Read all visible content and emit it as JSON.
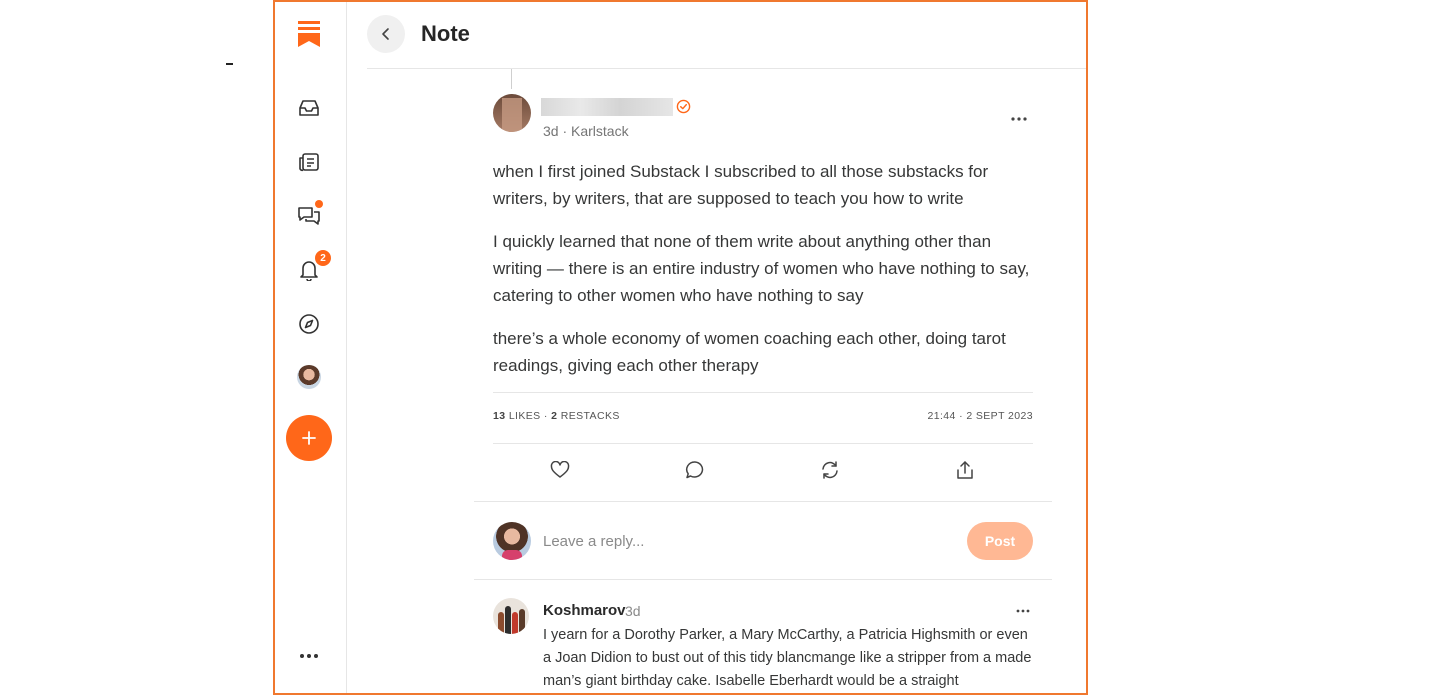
{
  "header": {
    "title": "Note"
  },
  "sidebar": {
    "notifications_badge": "2"
  },
  "post": {
    "meta": "3d · Karlstack",
    "paragraphs": [
      "when I first joined Substack I subscribed to all those substacks for writers, by writers, that are supposed to teach you how to write",
      "I quickly learned that none of them write about anything other than writing — there is an entire industry of women who have nothing to say, catering to other women who have nothing to say",
      "there’s a whole economy of women coaching each other, doing tarot readings, giving each other therapy"
    ],
    "likes_count": "13",
    "likes_label": "LIKES",
    "separator": "·",
    "restacks_count": "2",
    "restacks_label": "RESTACKS",
    "timestamp": "21:44 · 2 SEPT 2023"
  },
  "reply": {
    "placeholder": "Leave a reply...",
    "post_label": "Post"
  },
  "comment": {
    "author": "Koshmarov",
    "time": "3d",
    "body": "I yearn for a Dorothy Parker, a Mary McCarthy, a Patricia Highsmith or even a Joan Didion to bust out of this tidy blancmange like a stripper from a made man’s giant birthday cake. Isabelle Eberhardt would be a straight"
  },
  "colors": {
    "accent": "#ff6719",
    "frame_border": "#f0782f",
    "post_button_disabled": "#ffb894"
  },
  "icons": [
    "bookmark-logo-icon",
    "inbox-icon",
    "reader-icon",
    "chat-icon",
    "bell-icon",
    "compass-icon",
    "plus-icon",
    "more-icon",
    "back-chevron-icon",
    "verified-icon",
    "heart-icon",
    "comment-icon",
    "restack-icon",
    "share-icon"
  ]
}
